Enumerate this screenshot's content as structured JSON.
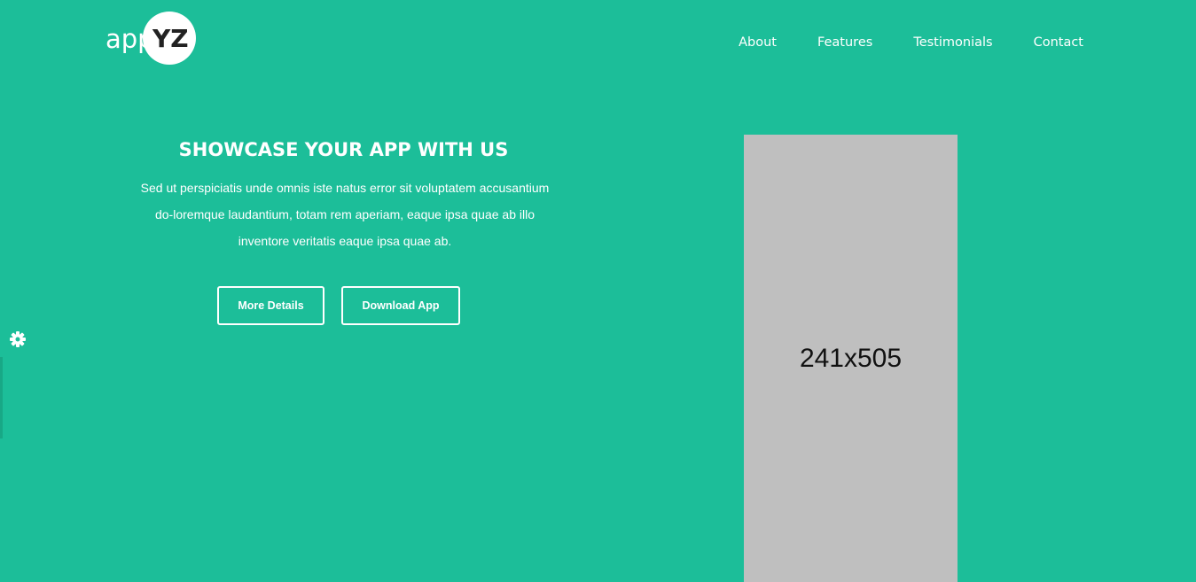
{
  "logo": {
    "part1": "app",
    "part2": "YZ"
  },
  "nav": {
    "items": [
      {
        "label": "About"
      },
      {
        "label": "Features"
      },
      {
        "label": "Testimonials"
      },
      {
        "label": "Contact"
      }
    ]
  },
  "hero": {
    "title": "SHOWCASE YOUR APP WITH US",
    "description_lines": [
      "Sed ut perspiciatis unde omnis iste natus error sit voluptatem accusantium",
      "do-loremque laudantium, totam rem aperiam, eaque ipsa quae ab illo",
      "inventore veritatis eaque ipsa quae ab."
    ],
    "more_details_label": "More Details",
    "download_label": "Download App"
  },
  "placeholder": {
    "label": "241x505"
  },
  "settings": {
    "icon": "gear-icon"
  },
  "colors": {
    "background": "#1cbe99",
    "text": "#ffffff",
    "placeholder": "#bfbfbf"
  }
}
